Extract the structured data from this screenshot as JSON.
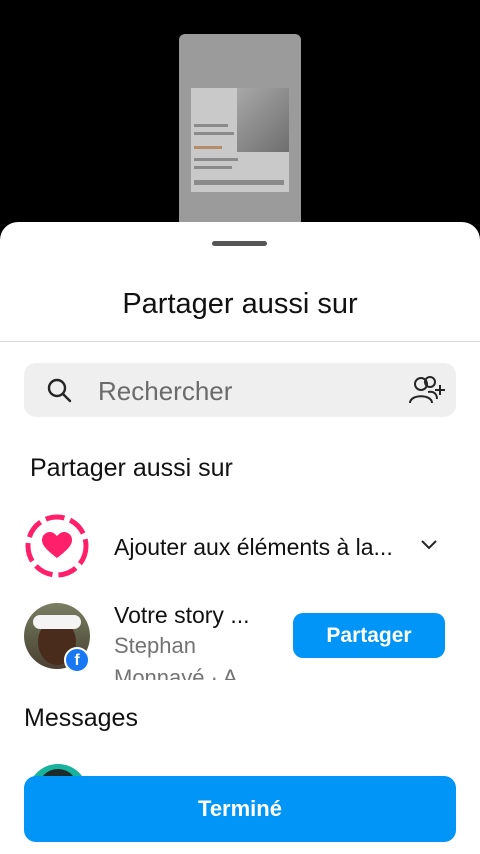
{
  "sheet": {
    "title": "Partager aussi sur"
  },
  "search": {
    "placeholder": "Rechercher",
    "icon": "search-icon",
    "add_icon": "add-people-icon"
  },
  "share_section": {
    "title": "Partager aussi sur",
    "highlights": {
      "label": "Ajouter aux éléments à la...",
      "icon": "heart-ring-icon"
    },
    "story": {
      "title": "Votre story ...",
      "account_line1": "Stephan",
      "account_line2": "Monnayé · A",
      "button": "Partager"
    }
  },
  "messages": {
    "title": "Messages"
  },
  "done_button": "Terminé",
  "colors": {
    "accent": "#0095f6",
    "highlight": "#ff1f6b",
    "facebook": "#1877f2"
  }
}
